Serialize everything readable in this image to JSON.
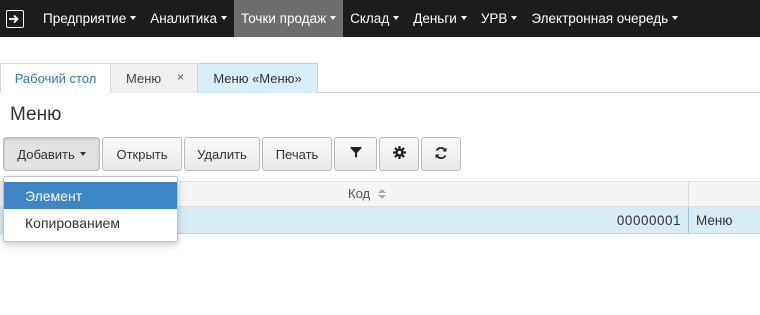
{
  "topnav": {
    "logo_icon": "arrow-right-box-icon",
    "items": [
      {
        "label": "Предприятие"
      },
      {
        "label": "Аналитика"
      },
      {
        "label": "Точки продаж"
      },
      {
        "label": "Склад"
      },
      {
        "label": "Деньги"
      },
      {
        "label": "УРВ"
      },
      {
        "label": "Электронная очередь"
      }
    ],
    "active_index": 2
  },
  "tabs": {
    "desktop": "Рабочий стол",
    "menu": "Меню",
    "menu_close": "×",
    "menu_item": "Меню «Меню»"
  },
  "page": {
    "title": "Меню"
  },
  "toolbar": {
    "add_label": "Добавить",
    "open_label": "Открыть",
    "delete_label": "Удалить",
    "print_label": "Печать",
    "filter_icon": "filter-icon",
    "settings_icon": "gear-icon",
    "refresh_icon": "refresh-icon"
  },
  "table": {
    "columns": [
      "Код"
    ],
    "rows": [
      {
        "code": "00000001",
        "name": "Меню"
      }
    ]
  },
  "dropdown": {
    "items": [
      {
        "label": "Элемент"
      },
      {
        "label": "Копированием"
      }
    ],
    "active_index": 0
  },
  "colors": {
    "nav_bg": "#1c1c1c",
    "nav_active": "#6e6e6e",
    "accent": "#3e87c7",
    "selected_row": "#d8ecf6"
  }
}
